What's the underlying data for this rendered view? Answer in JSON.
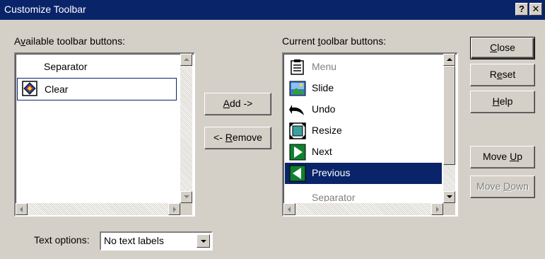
{
  "window": {
    "title": "Customize Toolbar",
    "help_glyph": "?",
    "close_glyph": "✕"
  },
  "available": {
    "label_pre": "A",
    "label_hot": "v",
    "label_post": "ailable toolbar buttons:",
    "items": [
      {
        "label": "Separator",
        "icon": "none"
      },
      {
        "label": "Clear",
        "icon": "clear-icon"
      }
    ]
  },
  "current": {
    "label_pre": "Current ",
    "label_hot": "t",
    "label_post": "oolbar buttons:",
    "items": [
      {
        "label": "Menu",
        "icon": "menu-icon"
      },
      {
        "label": "Slide",
        "icon": "slide-icon"
      },
      {
        "label": "Undo",
        "icon": "undo-icon"
      },
      {
        "label": "Resize",
        "icon": "resize-icon"
      },
      {
        "label": "Next",
        "icon": "next-icon"
      },
      {
        "label": "Previous",
        "icon": "previous-icon"
      },
      {
        "label": "Separator",
        "icon": "none"
      }
    ],
    "selected": "Previous"
  },
  "buttons": {
    "add": {
      "hot": "A",
      "rest": "dd ->"
    },
    "remove": {
      "pre": "<- ",
      "hot": "R",
      "rest": "emove"
    },
    "close": {
      "hot": "C",
      "rest": "lose"
    },
    "reset": {
      "pre": "R",
      "hot": "e",
      "rest": "set"
    },
    "help": {
      "hot": "H",
      "rest": "elp"
    },
    "move_up": {
      "pre": "Move ",
      "hot": "U",
      "rest": "p"
    },
    "move_down": {
      "pre": "Move ",
      "hot": "D",
      "rest": "own"
    }
  },
  "text_options": {
    "label": "Text options:",
    "value": "No text labels"
  },
  "colors": {
    "titlebar": "#0a246a",
    "face": "#d4d0c8",
    "selection": "#0a246a"
  }
}
